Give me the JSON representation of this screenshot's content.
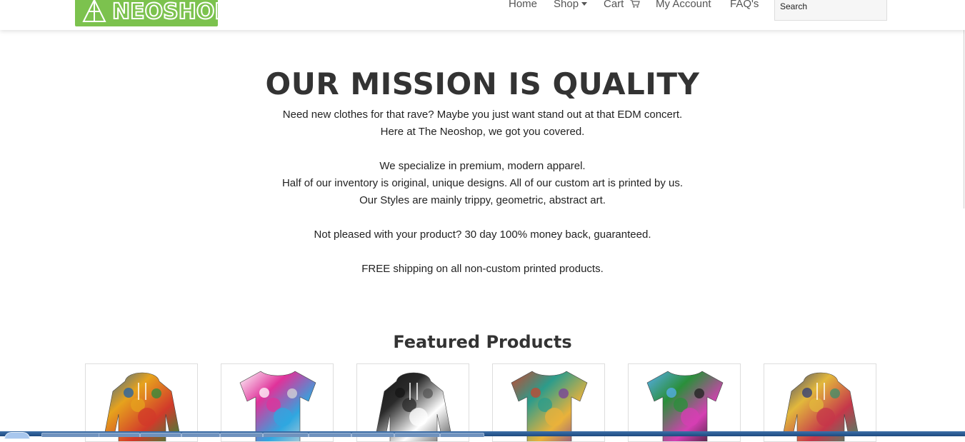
{
  "header": {
    "logo_text": "NEOSHOP",
    "nav": {
      "home": "Home",
      "shop": "Shop",
      "cart": "Cart",
      "my_account": "My Account",
      "faqs": "FAQ's"
    },
    "search_placeholder": "Search"
  },
  "mission": {
    "title": "OUR MISSION IS QUALITY",
    "lines": [
      "Need new clothes for that rave? Maybe you just want stand out at that EDM concert.",
      "Here at The Neoshop, we got you covered.",
      "We specialize in premium, modern apparel.",
      "Half of our inventory is original, unique designs. All of our custom art is printed by us.",
      "Our Styles are mainly trippy, geometric, abstract art.",
      "Not pleased with your product? 30 day 100% money back, guaranteed.",
      "FREE shipping on all non-custom printed products."
    ]
  },
  "featured": {
    "title": "Featured Products",
    "products": [
      {
        "type": "hoodie",
        "colors": [
          "#1f5fa8",
          "#e6a21d",
          "#d23a2a",
          "#2b8b3d"
        ]
      },
      {
        "type": "tshirt",
        "colors": [
          "#ffffff",
          "#e0329a",
          "#2fa7e0",
          "#d7d7d7"
        ]
      },
      {
        "type": "hoodie",
        "colors": [
          "#151515",
          "#2a2a2a",
          "#ffffff",
          "#555555"
        ]
      },
      {
        "type": "tshirt",
        "colors": [
          "#c7462f",
          "#2c9c8b",
          "#e9b23b",
          "#7a3f9b"
        ]
      },
      {
        "type": "tshirt",
        "colors": [
          "#58aef0",
          "#2a8f3a",
          "#d53fb3",
          "#1f1f1f"
        ]
      },
      {
        "type": "hoodie",
        "colors": [
          "#2b3a78",
          "#e2b83c",
          "#c6374a",
          "#3c8e6c"
        ]
      }
    ]
  },
  "colors": {
    "logo_green": "#7cc24e",
    "heading": "#333333",
    "nav_text": "#555555"
  }
}
